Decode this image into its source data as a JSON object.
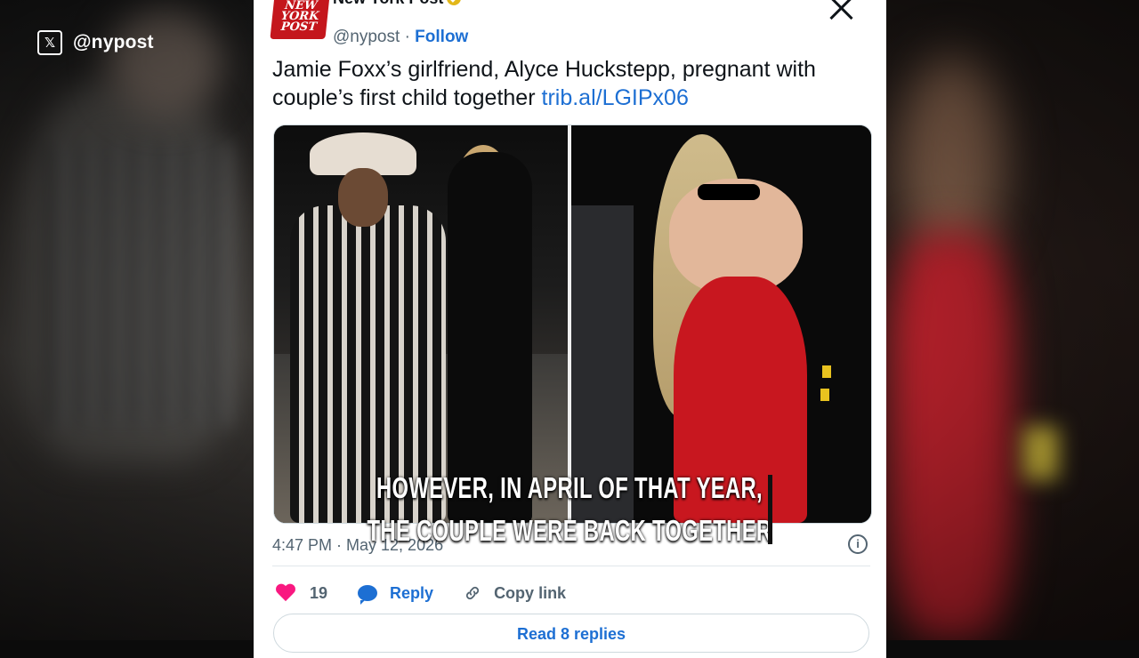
{
  "watermark": {
    "handle": "@nypost",
    "icon": "x-logo-icon"
  },
  "tweet": {
    "account_name": "New York Post",
    "avatar_lines": [
      "NEW",
      "YORK",
      "POST"
    ],
    "handle": "@nypost",
    "separator": "·",
    "follow_label": "Follow",
    "text": "Jamie Foxx’s girlfriend, Alyce Huckstepp, pregnant with couple’s first child together",
    "link": "trib.al/LGIPx06",
    "timestamp": "4:47 PM · May 12, 2026",
    "likes": "19",
    "reply_label": "Reply",
    "copy_link_label": "Copy link",
    "read_replies_label": "Read 8 replies"
  },
  "caption": {
    "line1": "HOWEVER, IN APRIL OF THAT YEAR,",
    "line2": "THE COUPLE WERE BACK TOGETHER"
  },
  "colors": {
    "accent": "#1d6fd3",
    "like": "#f91880",
    "brand_red": "#c4161c",
    "badge_gold": "#e2b719"
  }
}
